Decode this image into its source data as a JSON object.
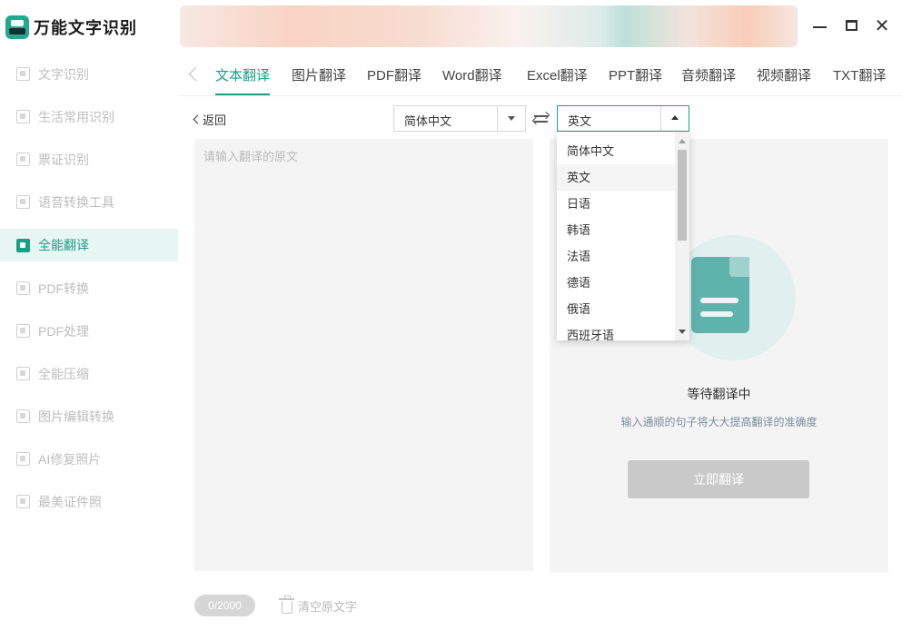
{
  "app": {
    "title": "万能文字识别",
    "logo_icon": "scanner-icon"
  },
  "sidebar": {
    "items": [
      {
        "label": "文字识别",
        "icon": "text-scan-icon",
        "active": false
      },
      {
        "label": "生活常用识别",
        "icon": "scan-icon",
        "active": false
      },
      {
        "label": "票证识别",
        "icon": "ticket-scan-icon",
        "active": false
      },
      {
        "label": "语音转换工具",
        "icon": "audio-icon",
        "active": false
      },
      {
        "label": "全能翻译",
        "icon": "translate-icon",
        "active": true
      },
      {
        "label": "PDF转换",
        "icon": "pdf-convert-icon",
        "active": false
      },
      {
        "label": "PDF处理",
        "icon": "pdf-process-icon",
        "active": false
      },
      {
        "label": "全能压缩",
        "icon": "compress-icon",
        "active": false
      },
      {
        "label": "图片编辑转换",
        "icon": "image-edit-icon",
        "active": false
      },
      {
        "label": "AI修复照片",
        "icon": "ai-photo-icon",
        "active": false
      },
      {
        "label": "最美证件照",
        "icon": "id-photo-icon",
        "active": false
      }
    ]
  },
  "tabs": [
    {
      "label": "文本翻译",
      "active": true
    },
    {
      "label": "图片翻译",
      "active": false
    },
    {
      "label": "PDF翻译",
      "active": false
    },
    {
      "label": "Word翻译",
      "active": false
    },
    {
      "label": "Excel翻译",
      "active": false
    },
    {
      "label": "PPT翻译",
      "active": false
    },
    {
      "label": "音频翻译",
      "active": false
    },
    {
      "label": "视频翻译",
      "active": false
    },
    {
      "label": "TXT翻译",
      "active": false
    }
  ],
  "toolbar": {
    "back_label": "返回",
    "source_language": "简体中文",
    "target_language": "英文"
  },
  "dropdown": {
    "options": [
      "简体中文",
      "英文",
      "日语",
      "韩语",
      "法语",
      "德语",
      "俄语",
      "西班牙语"
    ],
    "selected": "英文"
  },
  "input": {
    "placeholder": "请输入翻译的原文",
    "value": ""
  },
  "output": {
    "waiting_title": "等待翻译中",
    "waiting_hint": "输入通顺的句子将大大提高翻译的准确度",
    "translate_button": "立即翻译"
  },
  "footer": {
    "char_count": "0/2000",
    "clear_label": "清空原文字"
  },
  "colors": {
    "accent": "#1a9e86",
    "panel_bg": "#f4f4f4",
    "disabled_button": "#c9c9c9"
  }
}
